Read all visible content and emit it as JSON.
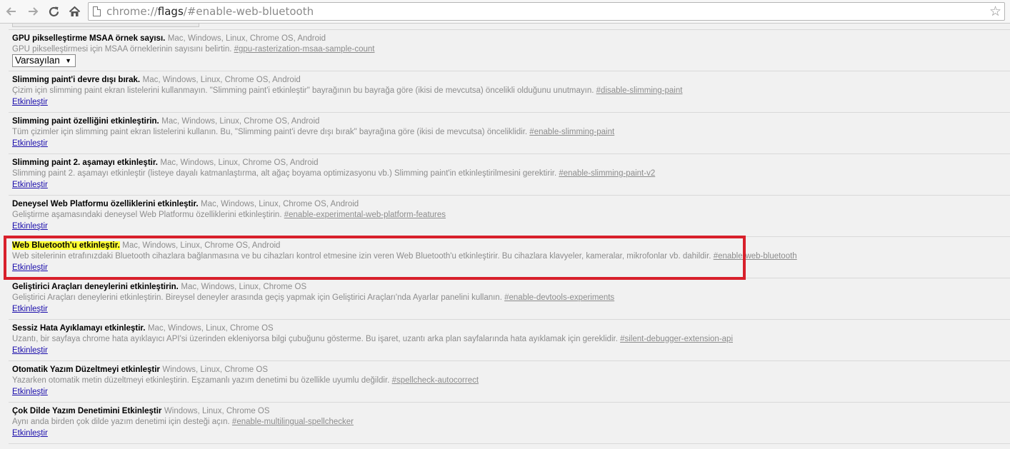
{
  "browser": {
    "url_scheme": "chrome://",
    "url_host": "flags",
    "url_path": "/#enable-web-bluetooth"
  },
  "icons": {
    "back": "back-arrow-icon",
    "forward": "forward-arrow-icon",
    "reload": "reload-icon",
    "home": "home-icon",
    "page": "page-icon",
    "bookmark": "star-icon"
  },
  "colors": {
    "link": "#1a0dab",
    "highlight": "#ffff33",
    "frame": "#d8202b"
  },
  "experiments": [
    {
      "title": "GPU pikselleştirme MSAA örnek sayısı.",
      "platforms": "Mac, Windows, Linux, Chrome OS, Android",
      "description": "GPU pikselleştirmesi için MSAA örneklerinin sayısını belirtin.",
      "permalink": "#gpu-rasterization-msaa-sample-count",
      "select_value": "Varsayılan"
    },
    {
      "title": "Slimming paint'i devre dışı bırak.",
      "platforms": "Mac, Windows, Linux, Chrome OS, Android",
      "description": "Çizim için slimming paint ekran listelerini kullanmayın. \"Slimming paint'i etkinleştir\" bayrağının bu bayrağa göre (ikisi de mevcutsa) öncelikli olduğunu unutmayın.",
      "permalink": "#disable-slimming-paint",
      "action": "Etkinleştir"
    },
    {
      "title": "Slimming paint özelliğini etkinleştirin.",
      "platforms": "Mac, Windows, Linux, Chrome OS, Android",
      "description": "Tüm çizimler için slimming paint ekran listelerini kullanın. Bu, \"Slimming paint'i devre dışı bırak\" bayrağına göre (ikisi de mevcutsa) önceliklidir.",
      "permalink": "#enable-slimming-paint",
      "action": "Etkinleştir"
    },
    {
      "title": "Slimming paint 2. aşamayı etkinleştir.",
      "platforms": "Mac, Windows, Linux, Chrome OS, Android",
      "description": "Slimming paint 2. aşamayı etkinleştir (listeye dayalı katmanlaştırma, alt ağaç boyama optimizasyonu vb.) Slimming paint'in etkinleştirilmesini gerektirir.",
      "permalink": "#enable-slimming-paint-v2",
      "action": "Etkinleştir"
    },
    {
      "title": "Deneysel Web Platformu özelliklerini etkinleştir.",
      "platforms": "Mac, Windows, Linux, Chrome OS, Android",
      "description": "Geliştirme aşamasındaki deneysel Web Platformu özelliklerini etkinleştirin.",
      "permalink": "#enable-experimental-web-platform-features",
      "action": "Etkinleştir"
    },
    {
      "title": "Web Bluetooth'u etkinleştir.",
      "platforms": "Mac, Windows, Linux, Chrome OS, Android",
      "description": "Web sitelerinin etrafınızdaki Bluetooth cihazlara bağlanmasına ve bu cihazları kontrol etmesine izin veren Web Bluetooth'u etkinleştirir. Bu cihazlara klavyeler, kameralar, mikrofonlar vb. dahildir.",
      "permalink": "#enable-web-bluetooth",
      "action": "Etkinleştir"
    },
    {
      "title": "Geliştirici Araçları deneylerini etkinleştirin.",
      "platforms": "Mac, Windows, Linux, Chrome OS",
      "description": "Geliştirici Araçları deneylerini etkinleştirin. Bireysel deneyler arasında geçiş yapmak için Geliştirici Araçları'nda Ayarlar panelini kullanın.",
      "permalink": "#enable-devtools-experiments",
      "action": "Etkinleştir"
    },
    {
      "title": "Sessiz Hata Ayıklamayı etkinleştir.",
      "platforms": "Mac, Windows, Linux, Chrome OS",
      "description": "Uzantı, bir sayfaya chrome hata ayıklayıcı API'si üzerinden ekleniyorsa bilgi çubuğunu gösterme. Bu işaret, uzantı arka plan sayfalarında hata ayıklamak için gereklidir.",
      "permalink": "#silent-debugger-extension-api",
      "action": "Etkinleştir"
    },
    {
      "title": "Otomatik Yazım Düzeltmeyi etkinleştir",
      "platforms": "Windows, Linux, Chrome OS",
      "description": "Yazarken otomatik metin düzeltmeyi etkinleştirin. Eşzamanlı yazım denetimi bu özellikle uyumlu değildir.",
      "permalink": "#spellcheck-autocorrect",
      "action": "Etkinleştir"
    },
    {
      "title": "Çok Dilde Yazım Denetimini Etkinleştir",
      "platforms": "Windows, Linux, Chrome OS",
      "description": "Aynı anda birden çok dilde yazım denetimi için desteği açın.",
      "permalink": "#enable-multilingual-spellchecker",
      "action": "Etkinleştir"
    }
  ]
}
